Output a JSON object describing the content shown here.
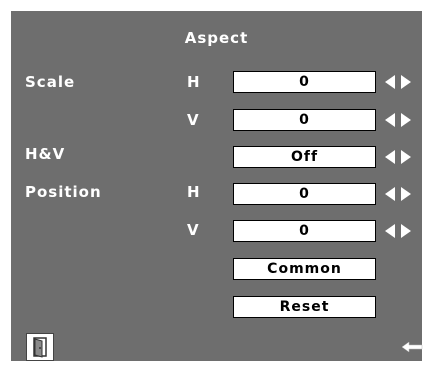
{
  "menu": {
    "title": "Aspect",
    "rows": [
      {
        "label": "Scale",
        "axis": "H",
        "value": "0"
      },
      {
        "label": "",
        "axis": "V",
        "value": "0"
      },
      {
        "label": "H&V",
        "axis": "",
        "value": "Off"
      },
      {
        "label": "Position",
        "axis": "H",
        "value": "0"
      },
      {
        "label": "",
        "axis": "V",
        "value": "0"
      }
    ],
    "buttons": {
      "common": "Common",
      "reset": "Reset"
    }
  },
  "icons": {
    "exit": "door-exit-icon",
    "back": "back-arrow-icon",
    "adjust": "left-right-arrows-icon"
  },
  "colors": {
    "panel_bg": "#6e6e6e",
    "text": "#ffffff",
    "field_bg": "#ffffff",
    "field_text": "#000000"
  }
}
